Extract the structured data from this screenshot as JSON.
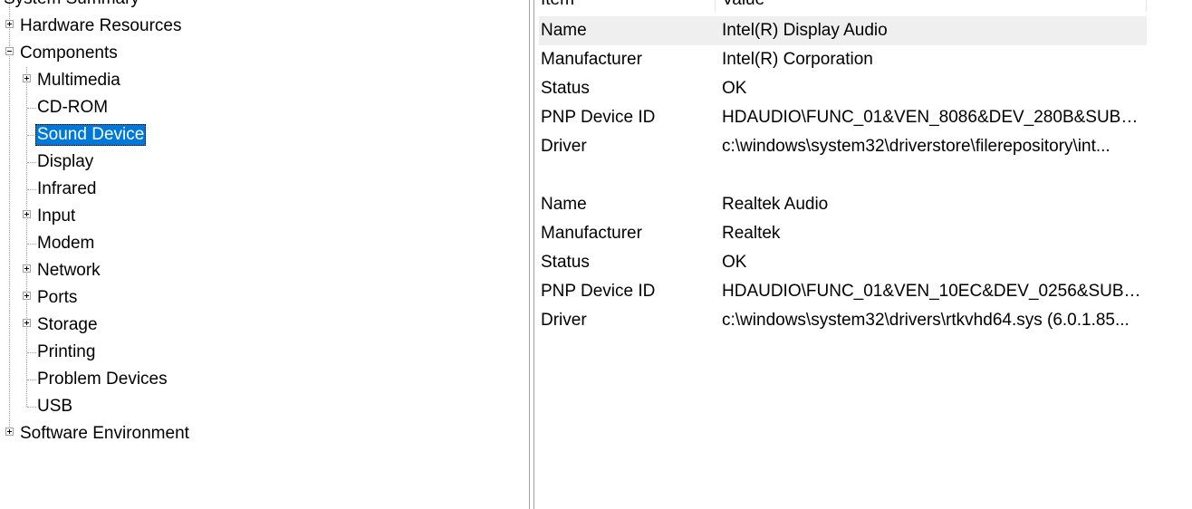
{
  "tree": {
    "system_summary": "System Summary",
    "hardware_resources": "Hardware Resources",
    "components": "Components",
    "multimedia": "Multimedia",
    "cdrom": "CD-ROM",
    "sound_device": "Sound Device",
    "display": "Display",
    "infrared": "Infrared",
    "input": "Input",
    "modem": "Modem",
    "network": "Network",
    "ports": "Ports",
    "storage": "Storage",
    "printing": "Printing",
    "problem_devices": "Problem Devices",
    "usb": "USB",
    "software_environment": "Software Environment"
  },
  "list": {
    "headers": {
      "item": "Item",
      "value": "Value"
    },
    "rows": [
      {
        "item": "Name",
        "value": "Intel(R) Display Audio"
      },
      {
        "item": "Manufacturer",
        "value": "Intel(R) Corporation"
      },
      {
        "item": "Status",
        "value": "OK"
      },
      {
        "item": "PNP Device ID",
        "value": "HDAUDIO\\FUNC_01&VEN_8086&DEV_280B&SUBS..."
      },
      {
        "item": "Driver",
        "value": "c:\\windows\\system32\\driverstore\\filerepository\\int..."
      },
      {
        "item": "",
        "value": ""
      },
      {
        "item": "Name",
        "value": "Realtek Audio"
      },
      {
        "item": "Manufacturer",
        "value": "Realtek"
      },
      {
        "item": "Status",
        "value": "OK"
      },
      {
        "item": "PNP Device ID",
        "value": "HDAUDIO\\FUNC_01&VEN_10EC&DEV_0256&SUBS..."
      },
      {
        "item": "Driver",
        "value": "c:\\windows\\system32\\drivers\\rtkvhd64.sys (6.0.1.85..."
      }
    ]
  },
  "colors": {
    "selection": "#0078d7",
    "row_highlight": "#efefef",
    "tree_lines": "#a0a0a0"
  },
  "icons": {
    "expand": "plus-box",
    "collapse": "minus-box"
  }
}
